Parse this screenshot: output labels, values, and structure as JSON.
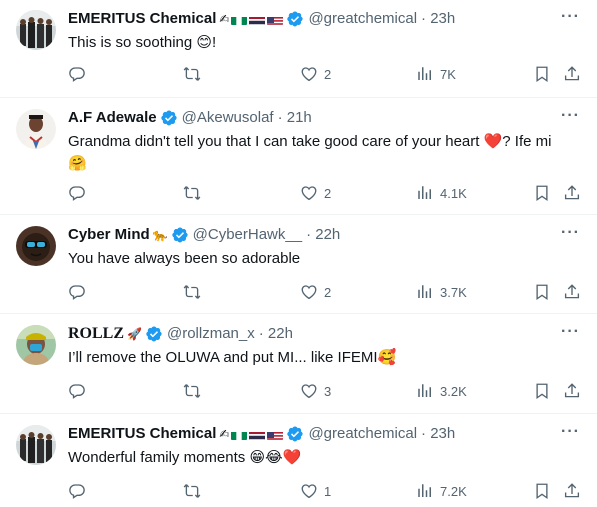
{
  "tweets": [
    {
      "name": "EMERITUS Chemical",
      "badges": "✍️🇳🇬🇹🇭🇺🇸",
      "handle": "@greatchemical",
      "time": "· 23h",
      "text": "This is so soothing 😊!",
      "replies": "",
      "retweets": "",
      "likes": "2",
      "views": "7K"
    },
    {
      "name": "A.F Adewale",
      "badges": "",
      "handle": "@Akewusolaf",
      "time": "· 21h",
      "text_line1": "Grandma didn't tell you that I can take good care of your heart ❤️? Ife mi",
      "text_line2": "🤗",
      "replies": "",
      "retweets": "",
      "likes": "2",
      "views": "4.1K"
    },
    {
      "name": "Cyber Mind",
      "badges": "🐆",
      "handle": "@CyberHawk__",
      "time": "· 22h",
      "text": "You have always been so adorable",
      "replies": "",
      "retweets": "",
      "likes": "2",
      "views": "3.7K"
    },
    {
      "name": "ROLLZ",
      "badges": "🚀",
      "handle": "@rollzman_x",
      "time": "· 22h",
      "text": "I’ll remove the OLUWA and put MI... like IFEMI🥰",
      "replies": "",
      "retweets": "",
      "likes": "3",
      "views": "3.2K"
    },
    {
      "name": "EMERITUS Chemical",
      "badges": "✍️🇳🇬🇹🇭🇺🇸",
      "handle": "@greatchemical",
      "time": "· 23h",
      "text": "Wonderful family moments 😁😂❤️",
      "replies": "",
      "retweets": "",
      "likes": "1",
      "views": "7.2K"
    }
  ],
  "colors": {
    "text": "#0f1419",
    "secondary": "#536471",
    "verified": "#1d9bf0",
    "divider": "#eff3f4"
  },
  "icons": [
    "reply-icon",
    "retweet-icon",
    "like-icon",
    "views-icon",
    "bookmark-icon",
    "share-icon",
    "more-icon",
    "verified-icon"
  ]
}
